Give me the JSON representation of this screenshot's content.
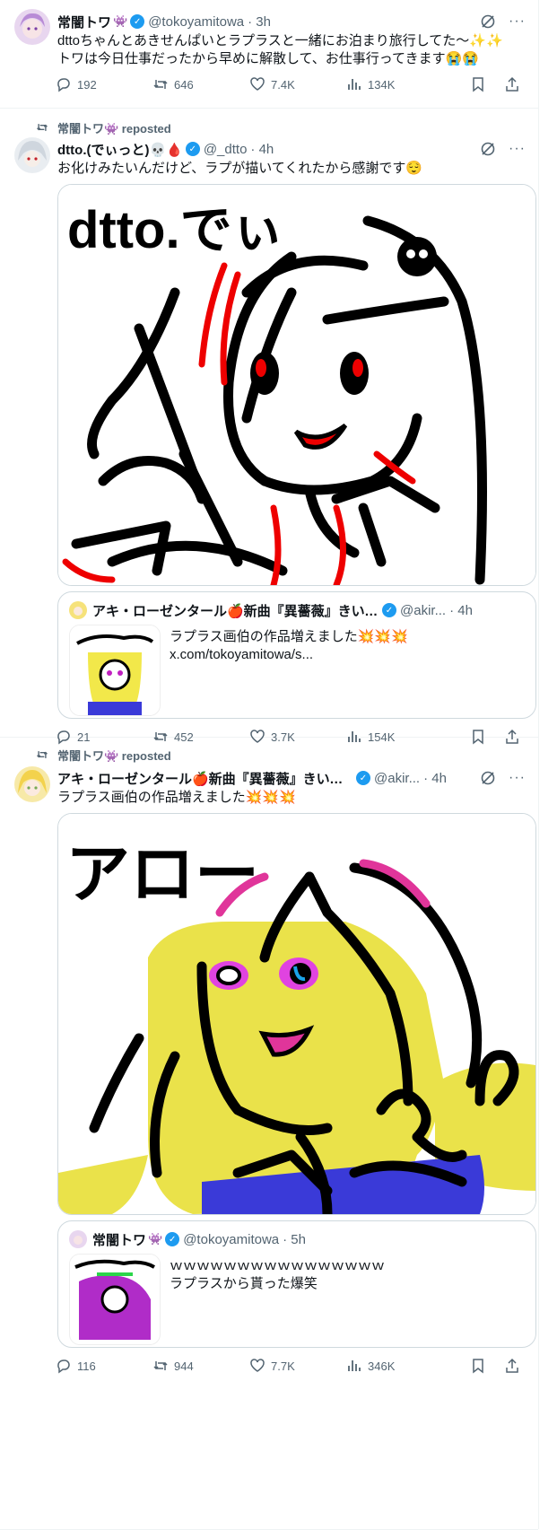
{
  "posts": [
    {
      "name": "常闇トワ",
      "handle": "@tokoyamitowa",
      "time": "· 3h",
      "text_line1": "dttoちゃんとあきせんぱいとラプラスと一緒にお泊まり旅行してた～✨✨",
      "text_line2": "トワは今日仕事だったから早めに解散して、お仕事行ってきます😭😭",
      "replies": "192",
      "reposts": "646",
      "likes": "7.4K",
      "views": "134K"
    },
    {
      "repost_label": "常闇トワ👾 reposted",
      "name": "dtto.(でぃっと)💀🩸",
      "handle": "@_dtto",
      "time": "· 4h",
      "text": "お化けみたいんだけど、ラプが描いてくれたから感謝です😌",
      "image_caption": "dtto.でぃ",
      "quote": {
        "name": "アキ・ローゼンタール🍎新曲『異薔薇』きいてね...",
        "handle": "@akir...",
        "time": "· 4h",
        "text": "ラプラス画伯の作品増えました💥💥💥",
        "link": "x.com/tokoyamitowa/s..."
      },
      "replies": "21",
      "reposts": "452",
      "likes": "3.7K",
      "views": "154K"
    },
    {
      "repost_label": "常闇トワ👾 reposted",
      "name": "アキ・ローゼンタール🍎新曲『異薔薇』きいてね...",
      "handle": "@akir...",
      "time": "· 4h",
      "text": "ラプラス画伯の作品増えました💥💥💥",
      "image_caption": "アロー",
      "quote": {
        "name": "常闇トワ",
        "handle": "@tokoyamitowa",
        "time": "· 5h",
        "text_line1": "ｗｗｗｗｗｗｗｗｗｗｗｗｗｗｗｗ",
        "text_line2": "ラプラスから貰った爆笑"
      },
      "replies": "116",
      "reposts": "944",
      "likes": "7.7K",
      "views": "346K"
    }
  ],
  "colors": {
    "accent": "#1d9bf0",
    "muted": "#536471",
    "border": "#cfd9de"
  }
}
